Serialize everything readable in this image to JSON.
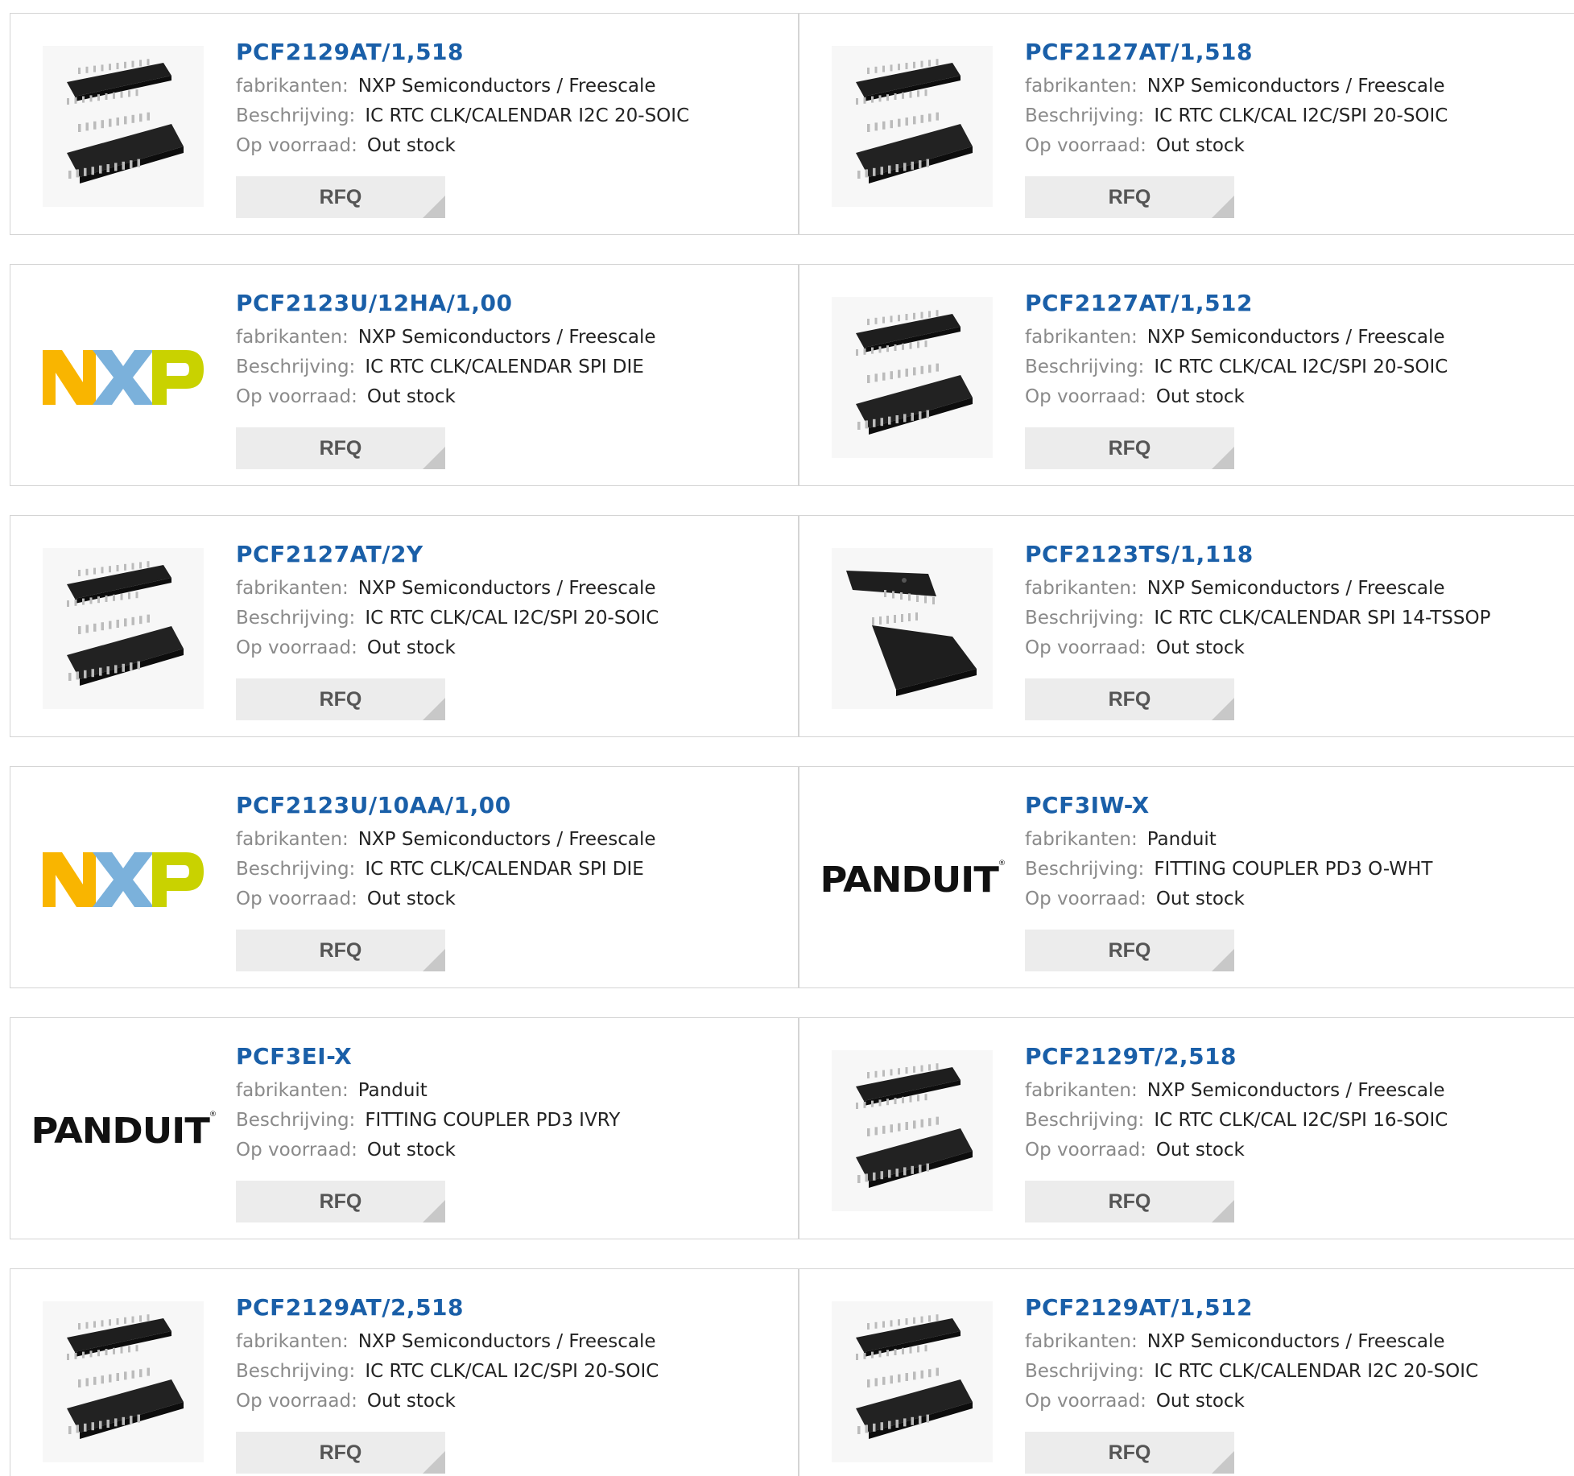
{
  "labels": {
    "manufacturer": "fabrikanten:",
    "description": "Beschrijving:",
    "stock": "Op voorraad:",
    "rfq": "RFQ"
  },
  "products": [
    {
      "pn": "PCF2129AT/1,518",
      "mfr": "NXP Semiconductors / Freescale",
      "desc": "IC RTC CLK/CALENDAR I2C 20-SOIC",
      "stock": "Out stock",
      "image": "soic-chip-icon"
    },
    {
      "pn": "PCF2127AT/1,518",
      "mfr": "NXP Semiconductors / Freescale",
      "desc": "IC RTC CLK/CAL I2C/SPI 20-SOIC",
      "stock": "Out stock",
      "image": "soic-chip-icon"
    },
    {
      "pn": "PCF2123U/12HA/1,00",
      "mfr": "NXP Semiconductors / Freescale",
      "desc": "IC RTC CLK/CALENDAR SPI DIE",
      "stock": "Out stock",
      "image": "nxp-logo"
    },
    {
      "pn": "PCF2127AT/1,512",
      "mfr": "NXP Semiconductors / Freescale",
      "desc": "IC RTC CLK/CAL I2C/SPI 20-SOIC",
      "stock": "Out stock",
      "image": "soic-chip-icon"
    },
    {
      "pn": "PCF2127AT/2Y",
      "mfr": "NXP Semiconductors / Freescale",
      "desc": "IC RTC CLK/CAL I2C/SPI 20-SOIC",
      "stock": "Out stock",
      "image": "soic-chip-icon"
    },
    {
      "pn": "PCF2123TS/1,118",
      "mfr": "NXP Semiconductors / Freescale",
      "desc": "IC RTC CLK/CALENDAR SPI 14-TSSOP",
      "stock": "Out stock",
      "image": "tssop-chip-icon"
    },
    {
      "pn": "PCF2123U/10AA/1,00",
      "mfr": "NXP Semiconductors / Freescale",
      "desc": "IC RTC CLK/CALENDAR SPI DIE",
      "stock": "Out stock",
      "image": "nxp-logo"
    },
    {
      "pn": "PCF3IW-X",
      "mfr": "Panduit",
      "desc": "FITTING COUPLER PD3 O-WHT",
      "stock": "Out stock",
      "image": "panduit-logo"
    },
    {
      "pn": "PCF3EI-X",
      "mfr": "Panduit",
      "desc": "FITTING COUPLER PD3 IVRY",
      "stock": "Out stock",
      "image": "panduit-logo"
    },
    {
      "pn": "PCF2129T/2,518",
      "mfr": "NXP Semiconductors / Freescale",
      "desc": "IC RTC CLK/CAL I2C/SPI 16-SOIC",
      "stock": "Out stock",
      "image": "soic-chip-icon"
    },
    {
      "pn": "PCF2129AT/2,518",
      "mfr": "NXP Semiconductors / Freescale",
      "desc": "IC RTC CLK/CAL I2C/SPI 20-SOIC",
      "stock": "Out stock",
      "image": "soic-chip-icon"
    },
    {
      "pn": "PCF2129AT/1,512",
      "mfr": "NXP Semiconductors / Freescale",
      "desc": "IC RTC CLK/CALENDAR I2C 20-SOIC",
      "stock": "Out stock",
      "image": "soic-chip-icon"
    }
  ],
  "logos": {
    "nxp": {
      "text": "NXP",
      "colors": [
        "#f9b500",
        "#7bb1db",
        "#c9d200"
      ]
    },
    "panduit": {
      "text": "PANDUIT"
    }
  },
  "colors": {
    "link": "#1a5fa8",
    "label": "#8a8a8a",
    "button_bg": "#ececec"
  }
}
